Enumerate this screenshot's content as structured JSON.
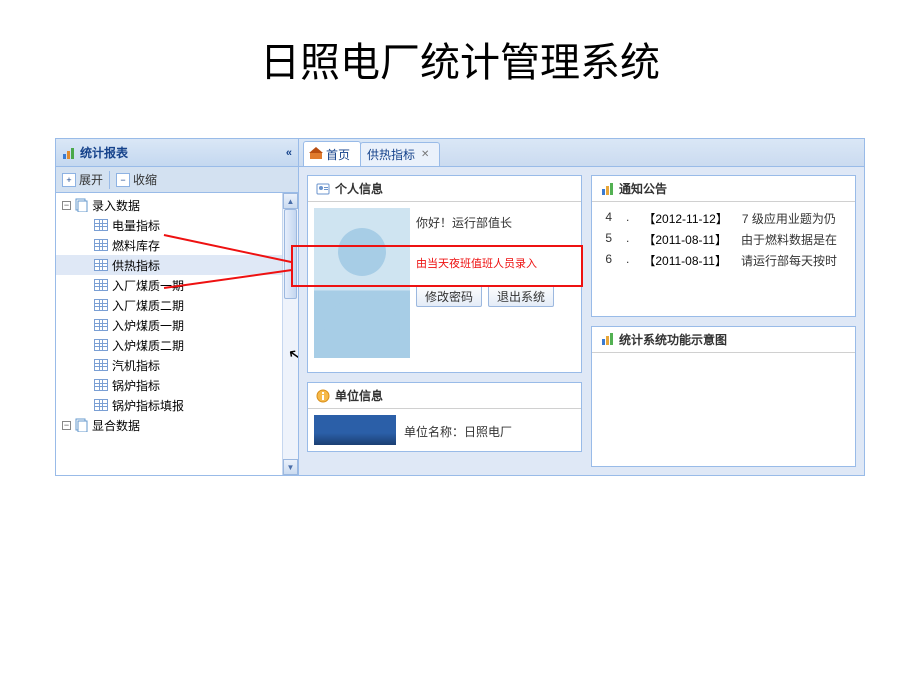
{
  "page_title": "日照电厂统计管理系统",
  "sidebar": {
    "title": "统计报表",
    "collapse_glyph": "«",
    "expand_label": "展开",
    "collapse_label": "收缩",
    "tree": {
      "root1": "录入数据",
      "items": [
        "电量指标",
        "燃料库存",
        "供热指标",
        "入厂煤质一期",
        "入厂煤质二期",
        "入炉煤质一期",
        "入炉煤质二期",
        "汽机指标",
        "锅炉指标",
        "锅炉指标填报"
      ],
      "root2": "显合数据"
    }
  },
  "tabs": {
    "home": "首页",
    "heat": "供热指标"
  },
  "personal": {
    "title": "个人信息",
    "greeting": "你好！运行部值长",
    "annotation": "由当天夜班值班人员录入",
    "btn_change_pwd": "修改密码",
    "btn_logout": "退出系统"
  },
  "org": {
    "title": "单位信息",
    "name_label": "单位名称：日照电厂"
  },
  "notice": {
    "title": "通知公告",
    "rows": [
      {
        "num": "4",
        "date": "【2012-11-12】",
        "text": "7 级应用业题为仍"
      },
      {
        "num": "5",
        "date": "【2011-08-11】",
        "text": "由于燃料数据是在"
      },
      {
        "num": "6",
        "date": "【2011-08-11】",
        "text": "请运行部每天按时"
      }
    ]
  },
  "diagram": {
    "title": "统计系统功能示意图"
  }
}
